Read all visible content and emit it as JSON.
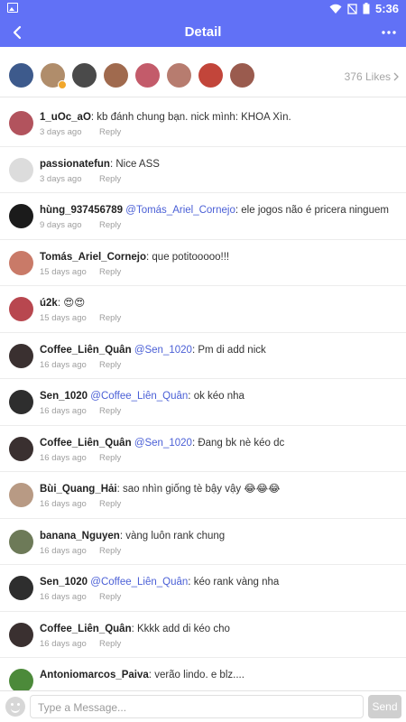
{
  "status_bar": {
    "time": "5:36"
  },
  "app_bar": {
    "title": "Detail"
  },
  "likes": {
    "count_label": "376 Likes",
    "avatars": [
      {
        "color": "#3d5a8c"
      },
      {
        "color": "#b08d6b",
        "badge": true
      },
      {
        "color": "#4a4a4a"
      },
      {
        "color": "#a06a4e"
      },
      {
        "color": "#c35b6a"
      },
      {
        "color": "#b77c6f"
      },
      {
        "color": "#c2453a"
      },
      {
        "color": "#9a5b4e"
      }
    ]
  },
  "comments": [
    {
      "user": "1_uOc_aO",
      "mention": "",
      "text": "kb đánh chung bạn. nick mình: KHOA Xìn.",
      "time": "3 days ago",
      "reply": "Reply",
      "avatar_color": "#b2535d"
    },
    {
      "user": "passionatefun",
      "mention": "",
      "text": "Nice ASS",
      "time": "3 days ago",
      "reply": "Reply",
      "avatar_color": "#dcdcdc"
    },
    {
      "user": "hùng_937456789",
      "mention": "@Tomás_Ariel_Cornejo",
      "text": "ele jogos não é pricera ninguem",
      "time": "9 days ago",
      "reply": "Reply",
      "avatar_color": "#1b1b1b"
    },
    {
      "user": "Tomás_Ariel_Cornejo",
      "mention": "",
      "text": "que potitooooo!!!",
      "time": "15 days ago",
      "reply": "Reply",
      "avatar_color": "#c97a68"
    },
    {
      "user": "ú2k",
      "mention": "",
      "text": "😍😍",
      "time": "15 days ago",
      "reply": "Reply",
      "avatar_color": "#b8474f"
    },
    {
      "user": "Coffee_Liên_Quân",
      "mention": "@Sen_1020",
      "text": "Pm di add nick",
      "time": "16 days ago",
      "reply": "Reply",
      "avatar_color": "#3a3030"
    },
    {
      "user": "Sen_1020",
      "mention": "@Coffee_Liên_Quân",
      "text": "ok kéo nha",
      "time": "16 days ago",
      "reply": "Reply",
      "avatar_color": "#2e2e2e"
    },
    {
      "user": "Coffee_Liên_Quân",
      "mention": "@Sen_1020",
      "text": "Đang bk nè kéo dc",
      "time": "16 days ago",
      "reply": "Reply",
      "avatar_color": "#3a3030"
    },
    {
      "user": "Bùi_Quang_Hải",
      "mention": "",
      "text": "sao nhìn giống tè bậy vậy 😂😂😂",
      "time": "16 days ago",
      "reply": "Reply",
      "avatar_color": "#b89a84"
    },
    {
      "user": "banana_Nguyen",
      "mention": "",
      "text": "vàng luôn rank chung",
      "time": "16 days ago",
      "reply": "Reply",
      "avatar_color": "#6d7a58"
    },
    {
      "user": "Sen_1020",
      "mention": "@Coffee_Liên_Quân",
      "text": "kéo rank vàng nha",
      "time": "16 days ago",
      "reply": "Reply",
      "avatar_color": "#2e2e2e"
    },
    {
      "user": "Coffee_Liên_Quân",
      "mention": "",
      "text": "Kkkk add di kéo cho",
      "time": "16 days ago",
      "reply": "Reply",
      "avatar_color": "#3a3030"
    },
    {
      "user": "Antoniomarcos_Paiva",
      "mention": "",
      "text": "verão lindo. e  blz....",
      "time": "",
      "reply": "",
      "avatar_color": "#4c8a3a"
    }
  ],
  "composer": {
    "placeholder": "Type a Message...",
    "send_label": "Send"
  },
  "colors": {
    "accent": "#6171f6",
    "mention": "#4a5fd6"
  }
}
